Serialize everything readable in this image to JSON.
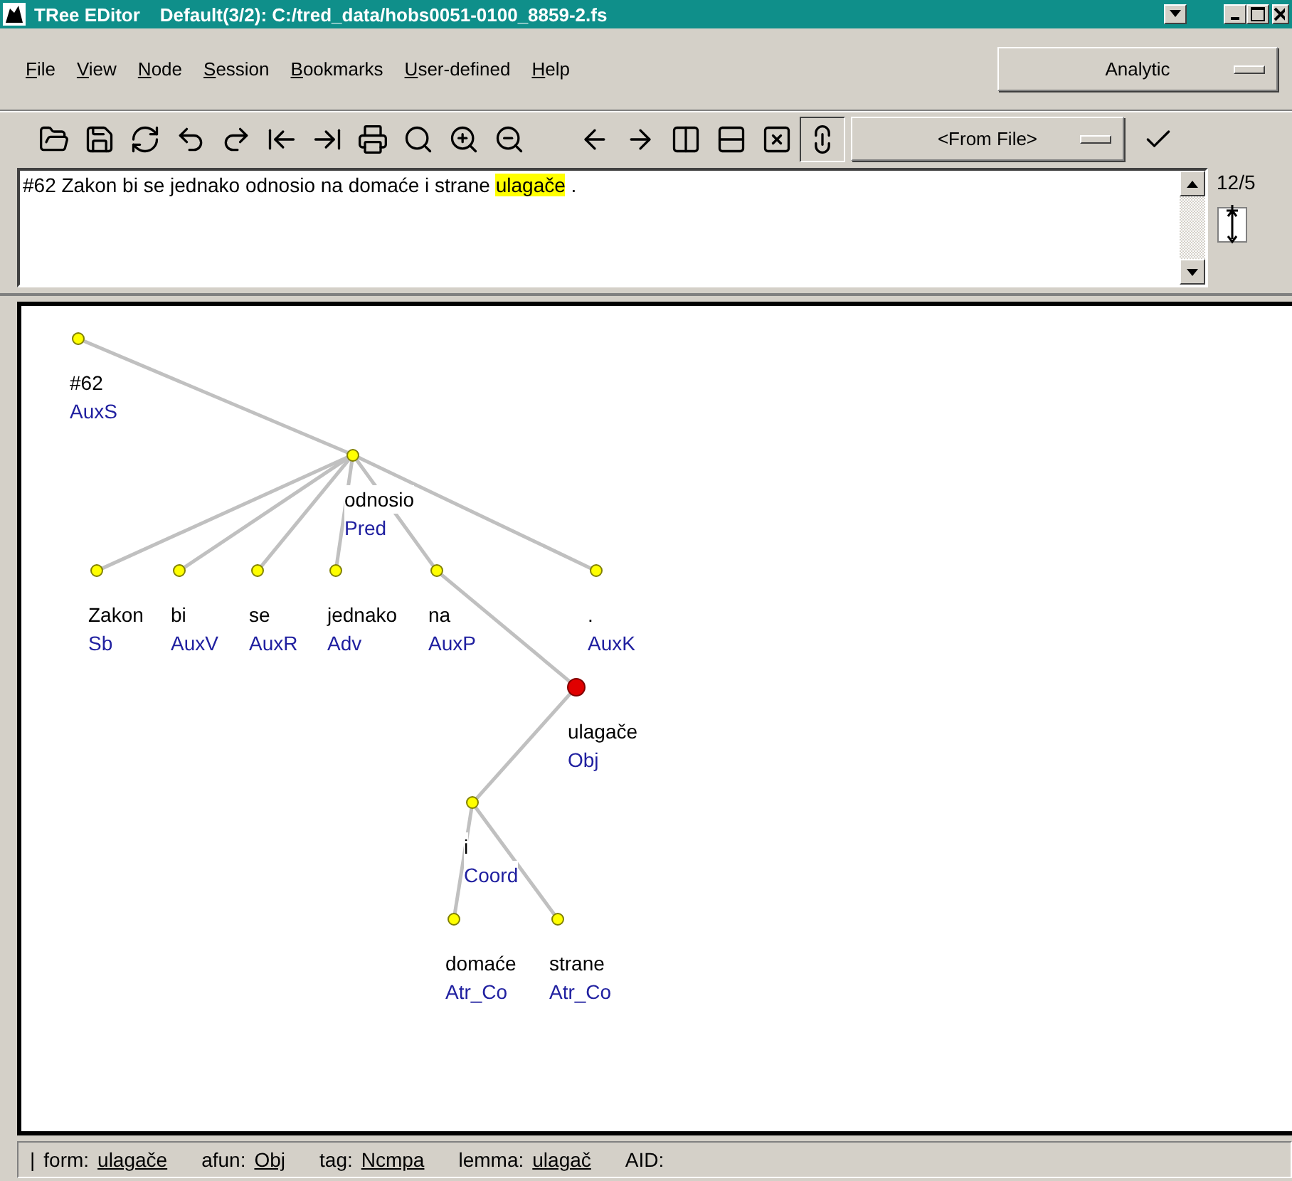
{
  "window": {
    "title_app": "TRee EDitor",
    "title_file": "Default(3/2): C:/tred_data/hobs0051-0100_8859-2.fs"
  },
  "menu": [
    "File",
    "View",
    "Node",
    "Session",
    "Bookmarks",
    "User-defined",
    "Help"
  ],
  "stylesheet": {
    "value": "Analytic"
  },
  "toolbar": {
    "pressed_link": true,
    "context": {
      "value": "<From File>"
    }
  },
  "sentence": [
    {
      "text": "#62 Zakon bi se jednako odnosio na domaće i strane ",
      "highlighted": false
    },
    {
      "text": "ulagače",
      "highlighted": true
    },
    {
      "text": " .",
      "highlighted": false
    }
  ],
  "tree_counter": "12/5",
  "tree": {
    "root": {
      "form": "#62",
      "afun": "AuxS",
      "selected": false,
      "children": [
        {
          "form": "odnosio",
          "afun": "Pred",
          "selected": false,
          "children": [
            {
              "form": "Zakon",
              "afun": "Sb",
              "selected": false
            },
            {
              "form": "bi",
              "afun": "AuxV",
              "selected": false
            },
            {
              "form": "se",
              "afun": "AuxR",
              "selected": false
            },
            {
              "form": "jednako",
              "afun": "Adv",
              "selected": false
            },
            {
              "form": "na",
              "afun": "AuxP",
              "selected": false,
              "children": [
                {
                  "form": "ulagače",
                  "afun": "Obj",
                  "selected": true,
                  "children": [
                    {
                      "form": "i",
                      "afun": "Coord",
                      "selected": false,
                      "children": [
                        {
                          "form": "domaće",
                          "afun": "Atr_Co",
                          "selected": false
                        },
                        {
                          "form": "strane",
                          "afun": "Atr_Co",
                          "selected": false
                        }
                      ]
                    }
                  ]
                }
              ]
            },
            {
              "form": ".",
              "afun": "AuxK",
              "selected": false
            }
          ]
        }
      ]
    }
  },
  "status_bar": {
    "separator": "|",
    "fields": [
      {
        "label": "form:",
        "value": "ulagače"
      },
      {
        "label": "afun:",
        "value": "Obj"
      },
      {
        "label": "tag:",
        "value": "Ncmpa"
      },
      {
        "label": "lemma:",
        "value": "ulagač"
      },
      {
        "label": "AID:"
      }
    ]
  }
}
